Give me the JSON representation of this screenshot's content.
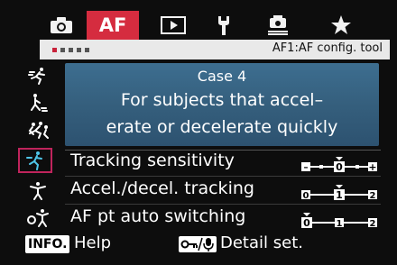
{
  "tabs": {
    "af_label": "AF",
    "items": [
      {
        "icon": "camera-icon"
      },
      {
        "icon": "af-tab"
      },
      {
        "icon": "playback-icon"
      },
      {
        "icon": "wrench-icon"
      },
      {
        "icon": "custom-function-icon"
      },
      {
        "icon": "star-icon"
      }
    ]
  },
  "subheader": {
    "page_dots": 5,
    "active_page": 1,
    "title": "AF1:AF config. tool"
  },
  "case_panel": {
    "title": "Case 4",
    "description_lines": [
      "For subjects that accel–",
      "erate or decelerate quickly"
    ]
  },
  "case_icons": [
    {
      "name": "case1-icon",
      "selected": false
    },
    {
      "name": "case2-icon",
      "selected": false
    },
    {
      "name": "case3-icon",
      "selected": false
    },
    {
      "name": "case4-icon",
      "selected": true
    },
    {
      "name": "case5-icon",
      "selected": false
    },
    {
      "name": "case6-icon",
      "selected": false
    }
  ],
  "settings": [
    {
      "label": "Tracking sensitivity",
      "scale_left": "–",
      "scale_mid": "0",
      "scale_right": "+",
      "value": 0
    },
    {
      "label": "Accel./decel. tracking",
      "scale_left": "0",
      "scale_mid": "1",
      "scale_right": "2",
      "value": 1
    },
    {
      "label": "AF pt auto switching",
      "scale_left": "0",
      "scale_mid": "1",
      "scale_right": "2",
      "value": 0
    }
  ],
  "footer": {
    "info_badge": "INFO.",
    "help_label": "Help",
    "detail_label": "Detail set."
  },
  "colors": {
    "accent": "#d52c3f",
    "panel": "#3a6a8a",
    "selection": "#c0245c"
  }
}
